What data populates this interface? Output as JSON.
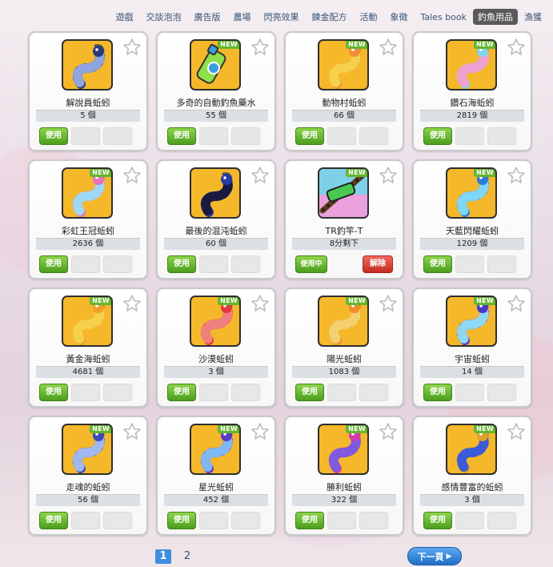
{
  "nav": {
    "tabs": [
      {
        "label": "遊戲"
      },
      {
        "label": "交談泡泡"
      },
      {
        "label": "廣告版"
      },
      {
        "label": "農場"
      },
      {
        "label": "閃亮效果"
      },
      {
        "label": "鍊金配方"
      },
      {
        "label": "活動"
      },
      {
        "label": "象徵"
      },
      {
        "label": "Tales book"
      },
      {
        "label": "釣魚用品"
      },
      {
        "label": "漁獲"
      }
    ],
    "active_index": 9
  },
  "labels": {
    "use": "使用",
    "using": "使用中",
    "remove": "解除",
    "new": "NEW"
  },
  "items": [
    {
      "name": "解說員蚯蚓",
      "qty": "5 個",
      "is_new": false,
      "icon": "worm-icon",
      "bg": "#f5b82a",
      "c1": "#2d3a78",
      "c2": "#8fa4e0"
    },
    {
      "name": "多奇的自動釣魚藥水",
      "qty": "55 個",
      "is_new": true,
      "icon": "potion-icon",
      "bg": "#f5b82a",
      "c1": "#3a9de0",
      "c2": "#8fe04a"
    },
    {
      "name": "動物村蚯蚓",
      "qty": "66 個",
      "is_new": true,
      "icon": "worm-icon",
      "bg": "#f5b82a",
      "c1": "#f08c3a",
      "c2": "#f5d04a"
    },
    {
      "name": "鑽石海蚯蚓",
      "qty": "2819 個",
      "is_new": true,
      "icon": "worm-icon",
      "bg": "#f5b82a",
      "c1": "#7fd6e8",
      "c2": "#f0a0d0"
    },
    {
      "name": "彩虹王冠蚯蚓",
      "qty": "2636 個",
      "is_new": true,
      "icon": "worm-icon",
      "bg": "#f5b82a",
      "c1": "#e86fb8",
      "c2": "#9fd8f5"
    },
    {
      "name": "最後的混沌蚯蚓",
      "qty": "60 個",
      "is_new": false,
      "icon": "worm-icon",
      "bg": "#f5b82a",
      "c1": "#2a3aa8",
      "c2": "#1a1a40"
    },
    {
      "name": "TR釣竿-T",
      "qty": "8分剩下",
      "is_new": true,
      "icon": "fishing-rod-icon",
      "bg": "#e5a8e0",
      "c1": "#1a1a1a",
      "c2": "#4ac850",
      "in_use": true
    },
    {
      "name": "天藍閃耀蚯蚓",
      "qty": "1209 個",
      "is_new": true,
      "icon": "worm-icon",
      "bg": "#f5b82a",
      "c1": "#2a7ae0",
      "c2": "#7fd6f5"
    },
    {
      "name": "黃金海蚯蚓",
      "qty": "4681 個",
      "is_new": true,
      "icon": "worm-icon",
      "bg": "#f5b82a",
      "c1": "#f0a02a",
      "c2": "#f5d04a"
    },
    {
      "name": "沙漠蚯蚓",
      "qty": "3 個",
      "is_new": true,
      "icon": "worm-icon",
      "bg": "#f5b82a",
      "c1": "#e03a3a",
      "c2": "#f08080"
    },
    {
      "name": "陽光蚯蚓",
      "qty": "1083 個",
      "is_new": true,
      "icon": "worm-icon",
      "bg": "#f5b82a",
      "c1": "#f08c2a",
      "c2": "#f5d070"
    },
    {
      "name": "宇宙蚯蚓",
      "qty": "14 個",
      "is_new": true,
      "icon": "worm-icon",
      "bg": "#f5b82a",
      "c1": "#4a3ac8",
      "c2": "#8fd8f5"
    },
    {
      "name": "走魂的蚯蚓",
      "qty": "56 個",
      "is_new": true,
      "icon": "worm-icon",
      "bg": "#f5b82a",
      "c1": "#3a4ab8",
      "c2": "#9fb8f0"
    },
    {
      "name": "星光蚯蚓",
      "qty": "452 個",
      "is_new": true,
      "icon": "worm-icon",
      "bg": "#f5b82a",
      "c1": "#5a3ac8",
      "c2": "#7fb8f5"
    },
    {
      "name": "勝利蚯蚓",
      "qty": "322 個",
      "is_new": true,
      "icon": "worm-icon",
      "bg": "#f5b82a",
      "c1": "#d83aa8",
      "c2": "#7f5ae0"
    },
    {
      "name": "感情豐富的蚯蚓",
      "qty": "3 個",
      "is_new": true,
      "icon": "worm-icon",
      "bg": "#f5b82a",
      "c1": "#e0a02a",
      "c2": "#3a5ad8"
    }
  ],
  "pagination": {
    "pages": [
      "1",
      "2"
    ],
    "current": "1",
    "next_label": "下一頁"
  },
  "colors": {
    "nav_active": "#5a5a5a",
    "use_button": "#4b9e1c",
    "remove_button": "#c42a1f",
    "new_badge": "#64b62c",
    "page_active": "#3d8ee0"
  }
}
